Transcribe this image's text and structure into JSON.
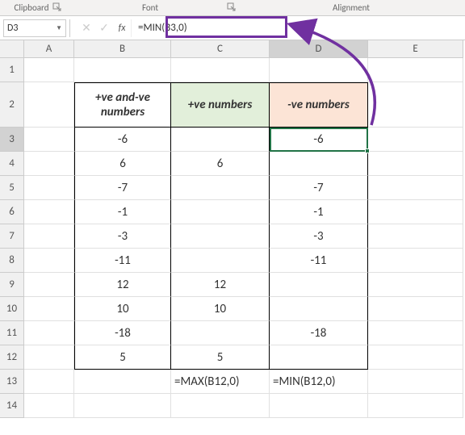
{
  "ribbon": {
    "clipboard": "Clipboard",
    "font": "Font",
    "alignment": "Alignment"
  },
  "formula_bar": {
    "name_box": "D3",
    "cancel": "✕",
    "enter": "✓",
    "fx": "fx",
    "formula": "=MIN(B3,0)"
  },
  "columns": [
    "A",
    "B",
    "C",
    "D",
    "E"
  ],
  "rows": [
    "1",
    "2",
    "3",
    "4",
    "5",
    "6",
    "7",
    "8",
    "9",
    "10",
    "11",
    "12",
    "13",
    "14"
  ],
  "headers": {
    "B": "+ve and-ve numbers",
    "C": "+ve numbers",
    "D": "-ve numbers"
  },
  "data": {
    "B": [
      "-6",
      "6",
      "-7",
      "-1",
      "-3",
      "-11",
      "12",
      "10",
      "-18",
      "5"
    ],
    "C": [
      "",
      "6",
      "",
      "",
      "",
      "",
      "12",
      "10",
      "",
      "5"
    ],
    "D": [
      "-6",
      "",
      "-7",
      "-1",
      "-3",
      "-11",
      "",
      "",
      "-18",
      ""
    ]
  },
  "row13": {
    "C": "=MAX(B12,0)",
    "D": "=MIN(B12,0)"
  },
  "colors": {
    "accent": "#7030a0",
    "select": "#217346"
  }
}
